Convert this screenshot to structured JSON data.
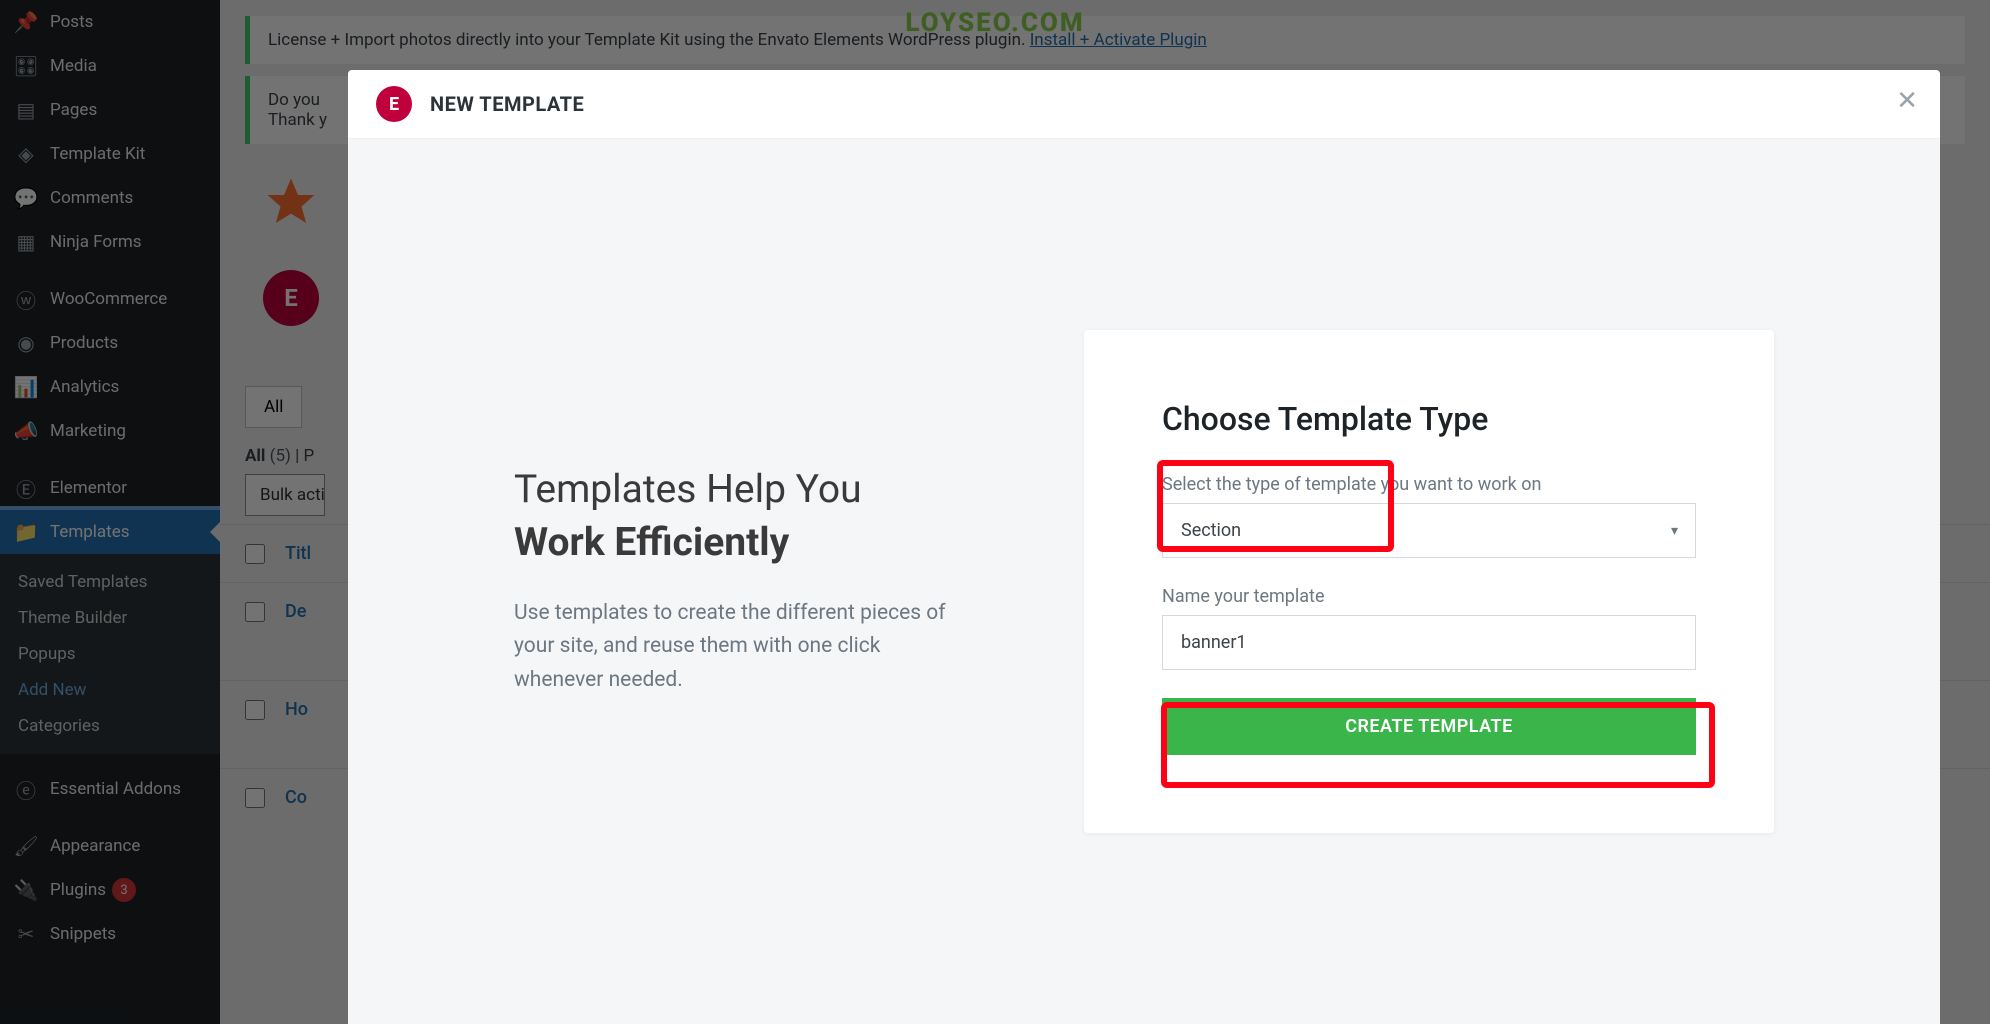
{
  "watermark": "LOYSEO.COM",
  "sidebar": {
    "items": [
      {
        "label": "Posts",
        "icon": "pin"
      },
      {
        "label": "Media",
        "icon": "media"
      },
      {
        "label": "Pages",
        "icon": "page"
      },
      {
        "label": "Template Kit",
        "icon": "kit"
      },
      {
        "label": "Comments",
        "icon": "comment"
      },
      {
        "label": "Ninja Forms",
        "icon": "form"
      },
      {
        "label": "WooCommerce",
        "icon": "woo"
      },
      {
        "label": "Products",
        "icon": "product"
      },
      {
        "label": "Analytics",
        "icon": "analytics"
      },
      {
        "label": "Marketing",
        "icon": "marketing"
      },
      {
        "label": "Elementor",
        "icon": "elementor"
      },
      {
        "label": "Templates",
        "icon": "folder",
        "active": true
      },
      {
        "label": "Essential Addons",
        "icon": "ea"
      },
      {
        "label": "Appearance",
        "icon": "brush"
      },
      {
        "label": "Plugins",
        "icon": "plugin",
        "badge": "3"
      },
      {
        "label": "Snippets",
        "icon": "scissors"
      }
    ],
    "sub": [
      {
        "label": "Saved Templates"
      },
      {
        "label": "Theme Builder"
      },
      {
        "label": "Popups"
      },
      {
        "label": "Add New",
        "highlight": true
      },
      {
        "label": "Categories"
      }
    ]
  },
  "notices": {
    "n1_prefix": "License + Import photos directly into your Template Kit using the Envato Elements WordPress plugin. ",
    "n1_link": "Install + Activate Plugin",
    "n2_line1": "Do you",
    "n2_line2": "Thank y"
  },
  "background": {
    "all_tab": "All",
    "filter_all": "All",
    "filter_count": "(5)",
    "filter_sep": " | ",
    "filter_p": "P",
    "bulk": "Bulk acti",
    "col_title": "Titl",
    "rows": [
      "De",
      "Ho",
      "Co"
    ]
  },
  "modal": {
    "title": "NEW TEMPLATE",
    "close": "✕",
    "left": {
      "line1": "Templates Help You",
      "line2": "Work Efficiently",
      "desc": "Use templates to create the different pieces of your site, and reuse them with one click whenever needed."
    },
    "form": {
      "heading": "Choose Template Type",
      "type_label": "Select the type of template you want to work on",
      "type_value": "Section",
      "name_label": "Name your template",
      "name_value": "banner1",
      "button": "CREATE TEMPLATE"
    }
  }
}
